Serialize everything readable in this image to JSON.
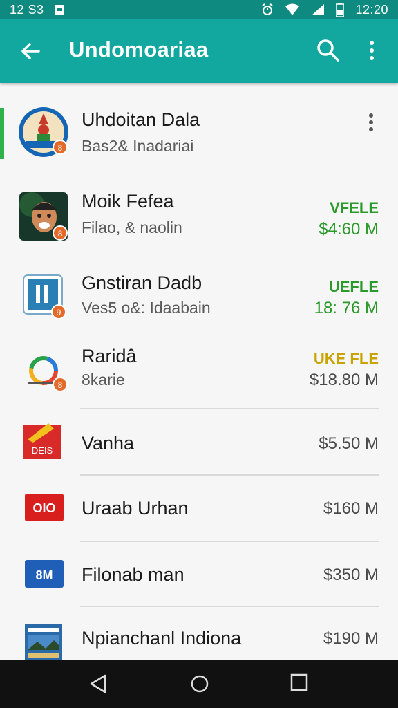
{
  "status_bar": {
    "left_text": "12 S3",
    "time": "12:20"
  },
  "app_bar": {
    "title": "Undomoariaa",
    "icons": [
      "back-arrow-icon",
      "search-icon",
      "more-vert-icon"
    ]
  },
  "apps": [
    {
      "name": "Uhdoitan Dala",
      "sub": "Bas2& Inadariai",
      "status": "",
      "size": "",
      "badge": "8",
      "icon": "emblem-app-icon",
      "menu": true
    },
    {
      "name": "Moik Fefea",
      "sub": "Filao, & naolin",
      "status": "VFELE",
      "size": "$4:60 M",
      "badge": "8",
      "icon": "face-app-icon",
      "status_color": "#2a9a2a",
      "size_color": "#2a9a2a"
    },
    {
      "name": "Gnstiran Dadb",
      "sub": "Ves5 o&: Idaabain",
      "status": "UEFLE",
      "size": "18: 76 M",
      "badge": "9",
      "icon": "letter-app-icon",
      "status_color": "#2a9a2a",
      "size_color": "#2a9a2a"
    },
    {
      "name": "Raridâ",
      "sub": "8karie",
      "status": "UKE FLE",
      "size": "$18.80 M",
      "badge": "8",
      "icon": "ring-app-icon",
      "status_color": "#c9a400",
      "size_color": "#4a4a4a"
    },
    {
      "name": "Vanha",
      "sub": "",
      "status": "",
      "size": "$5.50 M",
      "icon": "red-card-app-icon",
      "icon_text": "DEIS",
      "size_color": "#4a4a4a"
    },
    {
      "name": "Uraab Urhan",
      "sub": "",
      "status": "",
      "size": "$160 M",
      "icon": "red-label-app-icon",
      "icon_text": "OIO",
      "size_color": "#4a4a4a"
    },
    {
      "name": "Filonab man",
      "sub": "",
      "status": "",
      "size": "$350 M",
      "icon": "blue-label-app-icon",
      "icon_text": "8M",
      "size_color": "#4a4a4a"
    },
    {
      "name": "Npianchanl Indiona",
      "sub": "",
      "status": "",
      "size": "$190 M",
      "icon": "poster-app-icon",
      "size_color": "#4a4a4a"
    }
  ],
  "nav_bar": [
    "nav-back-icon",
    "nav-home-icon",
    "nav-recent-icon"
  ]
}
